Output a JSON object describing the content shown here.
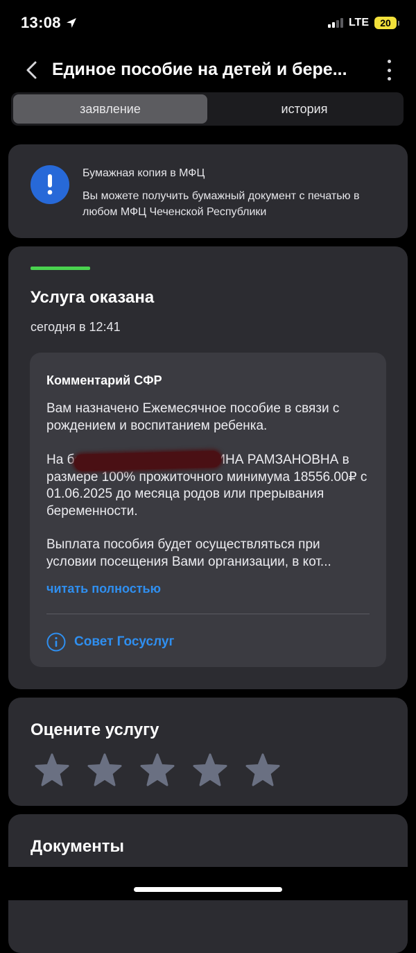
{
  "status_bar": {
    "time": "13:08",
    "network": "LTE",
    "battery": "20"
  },
  "header": {
    "title": "Единое пособие на детей и бере...",
    "back_icon": "chevron-left-icon",
    "menu_icon": "more-vertical-icon"
  },
  "tabs": [
    {
      "label": "заявление",
      "active": true
    },
    {
      "label": "история",
      "active": false
    }
  ],
  "mfc_notice": {
    "icon": "exclamation-icon",
    "title": "Бумажная копия в МФЦ",
    "text": "Вы можете получить бумажный документ с печатью в любом МФЦ Чеченской Республики"
  },
  "status": {
    "title": "Услуга оказана",
    "time": "сегодня в 12:41",
    "comment": {
      "title": "Комментарий СФР",
      "p1": "Вам назначено Ежемесячное пособие в связи с рождением и воспитанием ребенка.",
      "p2": "На беременную ХАДА МАДИНА РАМЗАНОВНА в размере 100% прожиточного минимума 18556.00₽ с 01.06.2025 до месяца родов или прерывания беременности.",
      "p3_line1": "Выплата пособия будет осуществляться при",
      "p3_line2": "условии посещения Вами организации, в кот...",
      "read_more": "читать полностью",
      "tip_label": "Совет Госуслуг"
    }
  },
  "rating": {
    "title": "Оцените услугу",
    "max_stars": 5,
    "selected": 0
  },
  "documents": {
    "title": "Документы"
  },
  "colors": {
    "background": "#000000",
    "card": "#2c2c31",
    "inner_card": "#3b3b41",
    "accent_blue": "#2f8ff0",
    "success_green": "#4ad34f",
    "info_blue": "#2769d8"
  }
}
